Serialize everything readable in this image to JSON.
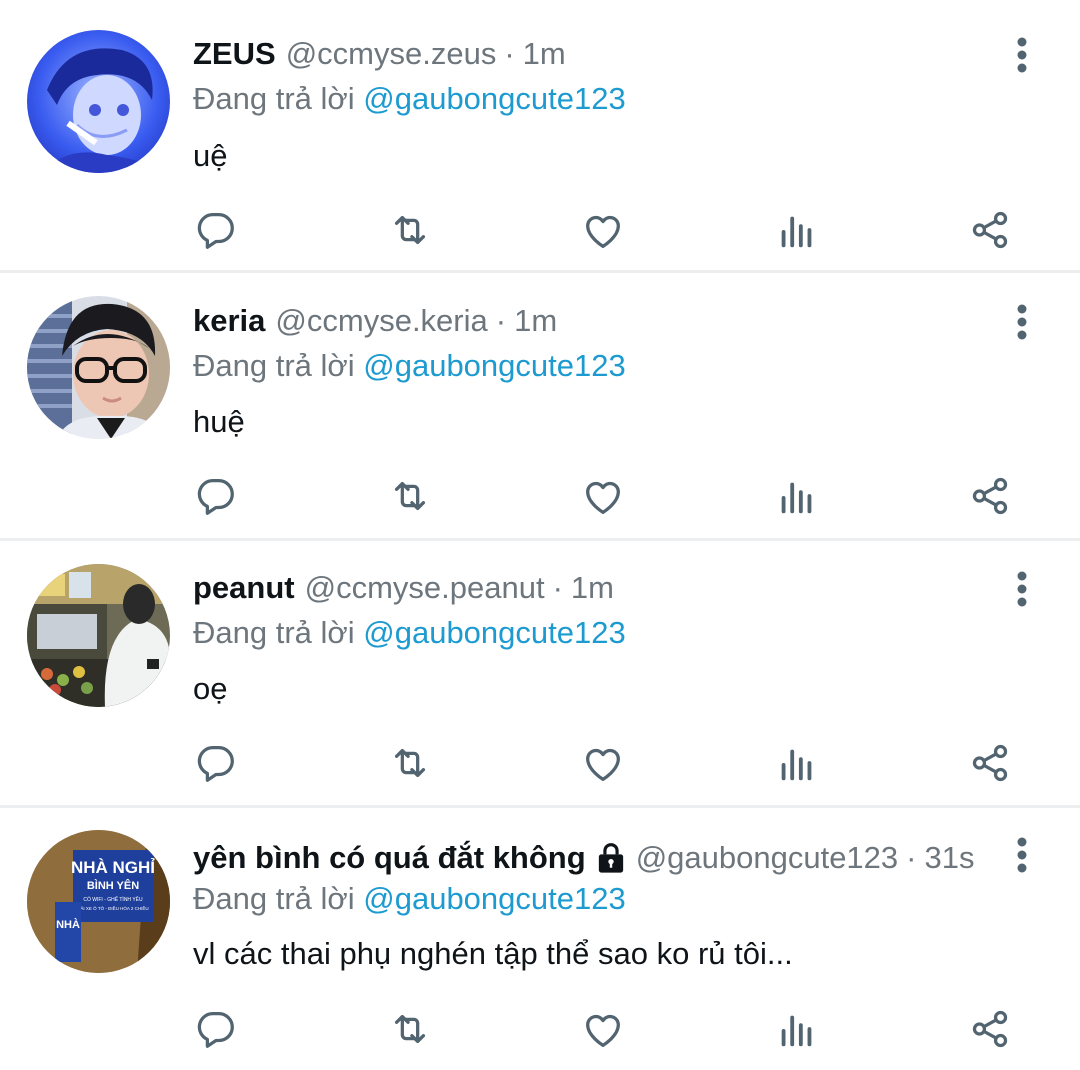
{
  "tweets": [
    {
      "name": "ZEUS",
      "handle": "@ccmyse.zeus",
      "separator": "·",
      "time": "1m",
      "replying_label": "Đang trả lời",
      "replying_to": "@gaubongcute123",
      "text": "uệ",
      "locked": false,
      "avatar": "blue-tinted-portrait"
    },
    {
      "name": "keria",
      "handle": "@ccmyse.keria",
      "separator": "·",
      "time": "1m",
      "replying_label": "Đang trả lời",
      "replying_to": "@gaubongcute123",
      "text": "huệ",
      "locked": false,
      "avatar": "portrait-with-glasses"
    },
    {
      "name": "peanut",
      "handle": "@ccmyse.peanut",
      "separator": "·",
      "time": "1m",
      "replying_label": "Đang trả lời",
      "replying_to": "@gaubongcute123",
      "text": "oẹ",
      "locked": false,
      "avatar": "person-at-market-stall"
    },
    {
      "name": "yên bình có quá đắt không",
      "handle": "@gaubongcute123",
      "separator": "·",
      "time": "31s",
      "replying_label": "Đang trả lời",
      "replying_to": "@gaubongcute123",
      "text": "vl các thai phụ nghén tập thể sao ko rủ tôi...",
      "locked": true,
      "avatar": "guesthouse-sign",
      "avatar_sign": {
        "line1": "NHÀ NGHỈ",
        "line2": "BÌNH YÊN",
        "line3": "CÓ WIFI - GHẾ TÌNH YÊU",
        "line4": "BÃI XE Ô TÔ - ĐIỀU HÒA 2 CHIỀU",
        "side": "NHÀ"
      }
    }
  ],
  "action_icons": [
    "reply-icon",
    "retweet-icon",
    "like-icon",
    "views-icon",
    "share-icon"
  ],
  "colors": {
    "text": "#0f1419",
    "secondary": "#6e767d",
    "mention": "#1d9bd0",
    "icon": "#536471",
    "divider": "#eceef0"
  }
}
